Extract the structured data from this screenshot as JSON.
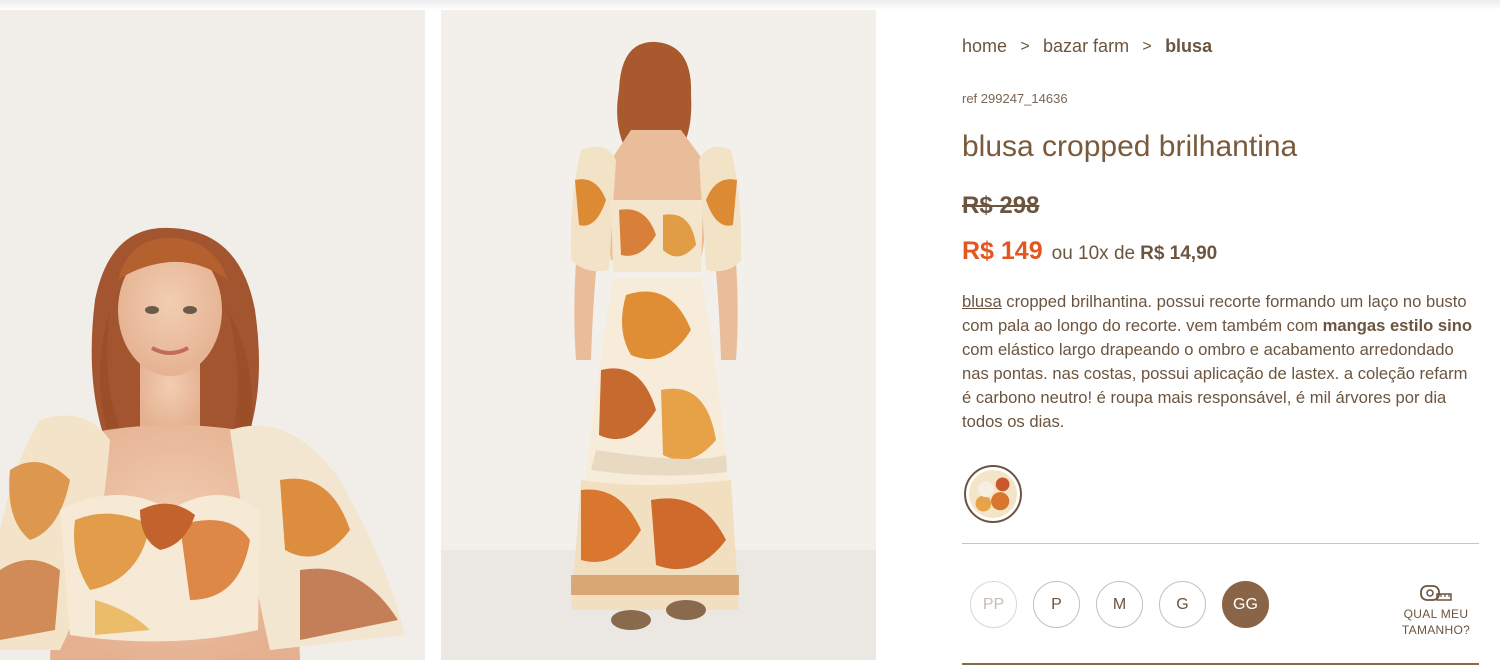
{
  "breadcrumb": {
    "items": [
      {
        "label": "home"
      },
      {
        "label": "bazar farm"
      },
      {
        "label": "blusa"
      }
    ],
    "separator": ">"
  },
  "product": {
    "ref": "ref 299247_14636",
    "title": "blusa cropped brilhantina",
    "old_price": "R$ 298",
    "price": "R$ 149",
    "installments_text": "ou 10x de",
    "installment_value": "R$ 14,90",
    "description": {
      "link_word": "blusa",
      "part1": " cropped brilhantina. possui recorte formando um laço no busto com pala ao longo do recorte. vem também com ",
      "bold1": "mangas estilo sino",
      "part2": " com elástico largo drapeando o ombro e acabamento arredondado nas pontas. nas costas, possui aplicação de lastex. a coleção refarm é carbono neutro! é roupa mais responsável, é mil árvores por dia todos os dias."
    }
  },
  "colors": {
    "accent_price": "#e4561f",
    "text_brown": "#6b5540",
    "selected_size": "#8a6446"
  },
  "sizes": [
    {
      "label": "PP",
      "state": "disabled"
    },
    {
      "label": "P",
      "state": "available"
    },
    {
      "label": "M",
      "state": "available"
    },
    {
      "label": "G",
      "state": "available"
    },
    {
      "label": "GG",
      "state": "selected"
    }
  ],
  "size_guide": {
    "line1": "QUAL MEU",
    "line2": "TAMANHO?",
    "icon": "measuring-tape-icon"
  },
  "swatch": {
    "icon": "print-swatch"
  }
}
